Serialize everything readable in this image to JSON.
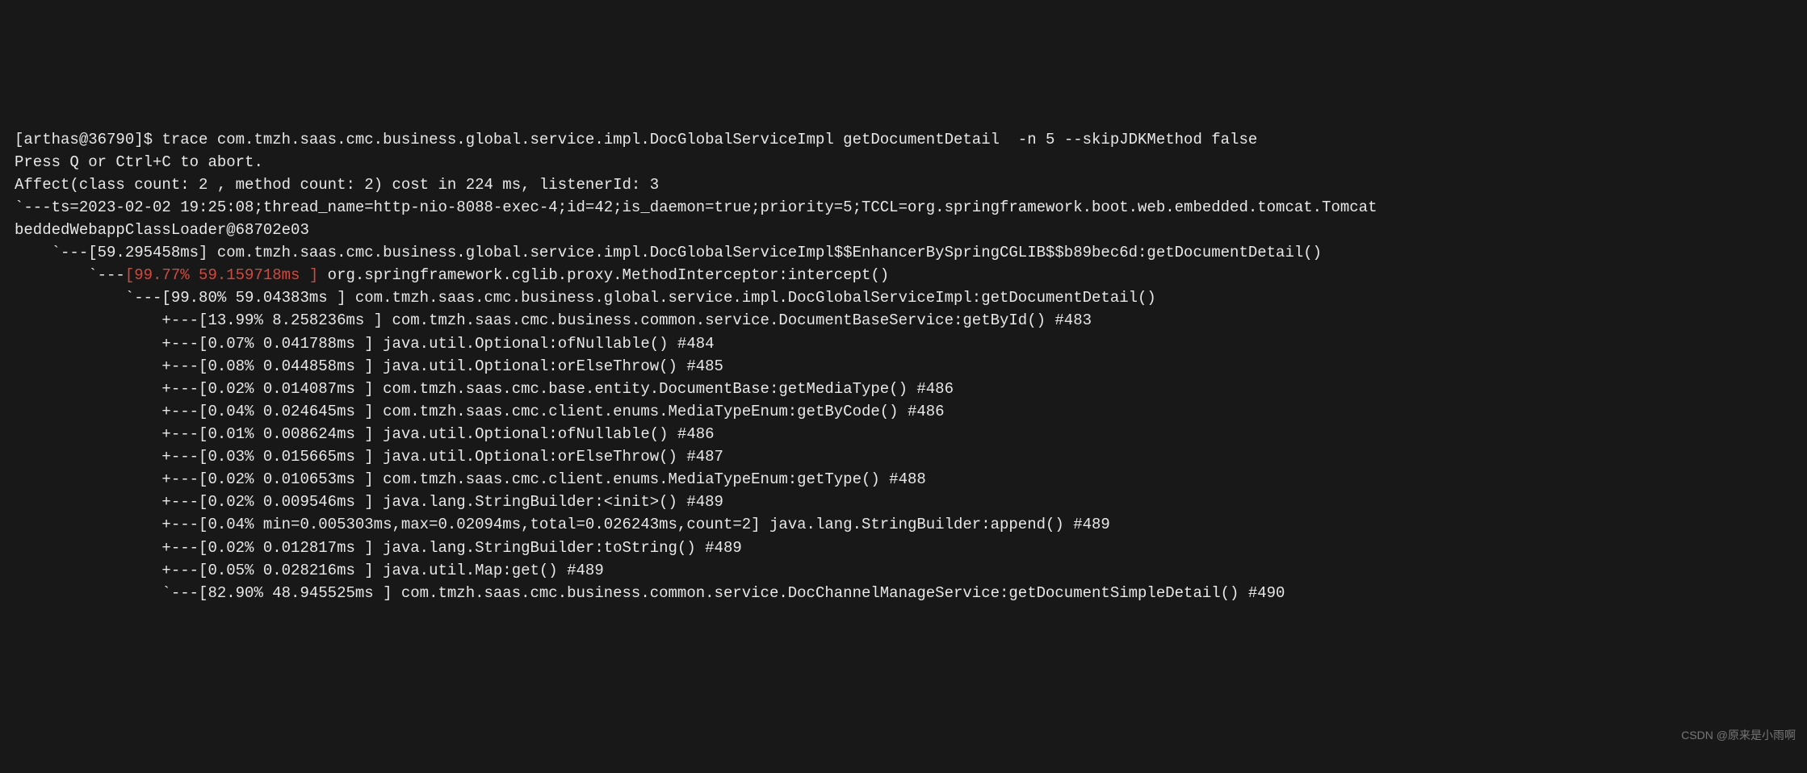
{
  "prompt": "[arthas@36790]$ ",
  "command": "trace com.tmzh.saas.cmc.business.global.service.impl.DocGlobalServiceImpl getDocumentDetail  -n 5 --skipJDKMethod false",
  "abort_hint": "Press Q or Ctrl+C to abort.",
  "affect_line": "Affect(class count: 2 , method count: 2) cost in 224 ms, listenerId: 3",
  "ts_line": "`---ts=2023-02-02 19:25:08;thread_name=http-nio-8088-exec-4;id=42;is_daemon=true;priority=5;TCCL=org.springframework.boot.web.embedded.tomcat.Tomcat",
  "ts_line2": "beddedWebappClassLoader@68702e03",
  "tree": {
    "l0": "    `---[59.295458ms] com.tmzh.saas.cmc.business.global.service.impl.DocGlobalServiceImpl$$EnhancerBySpringCGLIB$$b89bec6d:getDocumentDetail()",
    "l1_prefix": "        `---",
    "l1_red": "[99.77% 59.159718ms ]",
    "l1_rest": " org.springframework.cglib.proxy.MethodInterceptor:intercept()",
    "l2": "            `---[99.80% 59.04383ms ] com.tmzh.saas.cmc.business.global.service.impl.DocGlobalServiceImpl:getDocumentDetail()",
    "l3": "                +---[13.99% 8.258236ms ] com.tmzh.saas.cmc.business.common.service.DocumentBaseService:getById() #483",
    "l4": "                +---[0.07% 0.041788ms ] java.util.Optional:ofNullable() #484",
    "l5": "                +---[0.08% 0.044858ms ] java.util.Optional:orElseThrow() #485",
    "l6": "                +---[0.02% 0.014087ms ] com.tmzh.saas.cmc.base.entity.DocumentBase:getMediaType() #486",
    "l7": "                +---[0.04% 0.024645ms ] com.tmzh.saas.cmc.client.enums.MediaTypeEnum:getByCode() #486",
    "l8": "                +---[0.01% 0.008624ms ] java.util.Optional:ofNullable() #486",
    "l9": "                +---[0.03% 0.015665ms ] java.util.Optional:orElseThrow() #487",
    "l10": "                +---[0.02% 0.010653ms ] com.tmzh.saas.cmc.client.enums.MediaTypeEnum:getType() #488",
    "l11": "                +---[0.02% 0.009546ms ] java.lang.StringBuilder:<init>() #489",
    "l12": "                +---[0.04% min=0.005303ms,max=0.02094ms,total=0.026243ms,count=2] java.lang.StringBuilder:append() #489",
    "l13": "                +---[0.02% 0.012817ms ] java.lang.StringBuilder:toString() #489",
    "l14": "                +---[0.05% 0.028216ms ] java.util.Map:get() #489",
    "l15": "                `---[82.90% 48.945525ms ] com.tmzh.saas.cmc.business.common.service.DocChannelManageService:getDocumentSimpleDetail() #490"
  },
  "watermark": "CSDN @原来是小雨啊"
}
